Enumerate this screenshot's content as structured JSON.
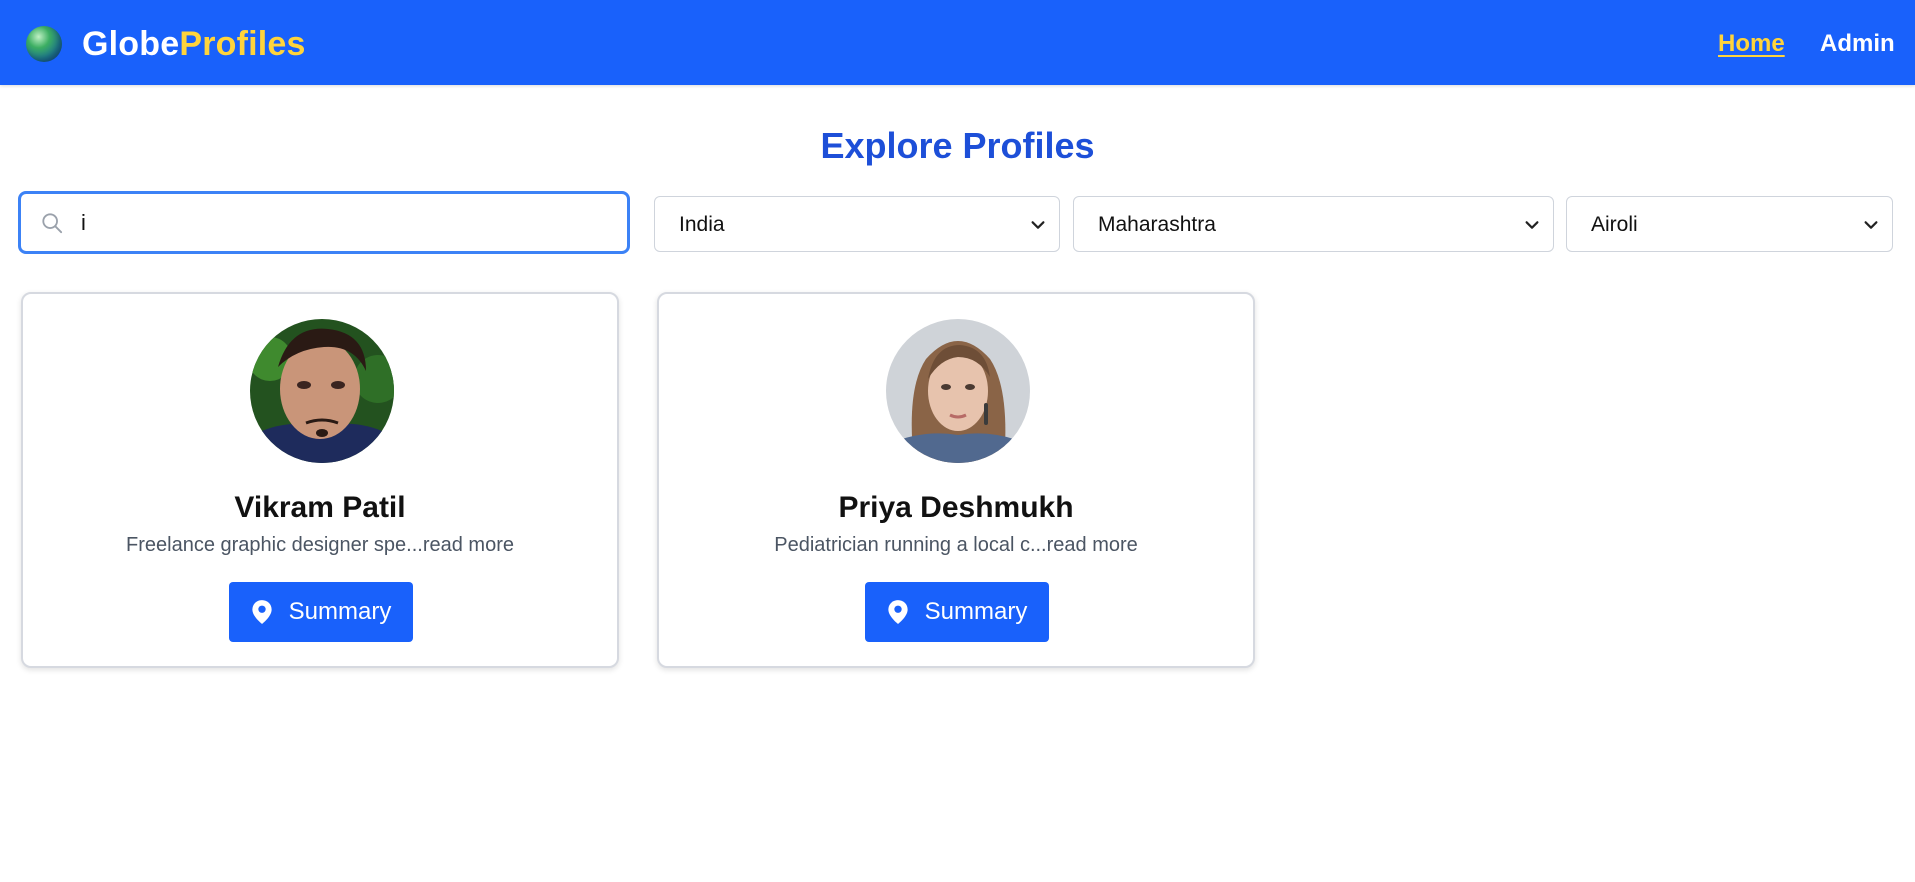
{
  "navbar": {
    "brand_part1": "Globe",
    "brand_part2": "Profiles",
    "links": [
      {
        "label": "Home",
        "active": true
      },
      {
        "label": "Admin",
        "active": false
      }
    ]
  },
  "page": {
    "title": "Explore Profiles"
  },
  "filters": {
    "search_value": "i",
    "search_icon": "search-icon",
    "country": "India",
    "state": "Maharashtra",
    "city": "Airoli"
  },
  "profiles": [
    {
      "name": "Vikram Patil",
      "description": "Freelance graphic designer spe...",
      "read_more": "read more",
      "button_label": "Summary",
      "button_icon": "map-pin-icon"
    },
    {
      "name": "Priya Deshmukh",
      "description": "Pediatrician running a local c...",
      "read_more": "read more",
      "button_label": "Summary",
      "button_icon": "map-pin-icon"
    }
  ],
  "colors": {
    "navbar_bg": "#1961fb",
    "brand_accent": "#ffd43b",
    "title": "#1d4fd8",
    "button_bg": "#1961fb",
    "search_focus_border": "#3c82f6"
  }
}
